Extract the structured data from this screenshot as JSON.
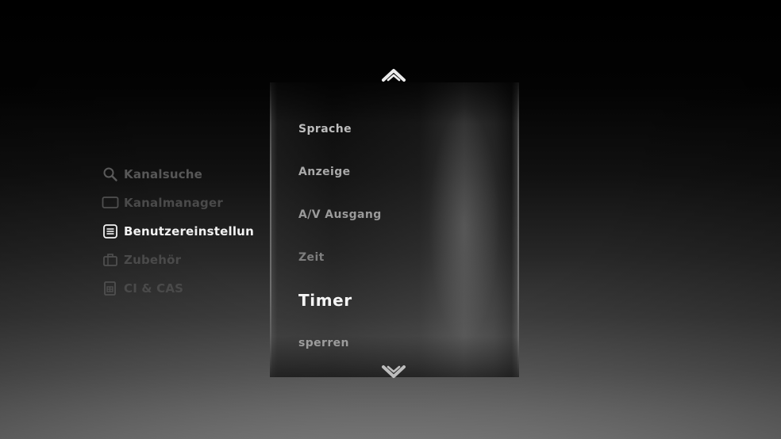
{
  "left_menu": {
    "items": [
      {
        "label": "Kanalsuche",
        "icon": "magnifier-icon",
        "state": "inactive"
      },
      {
        "label": "Kanalmanager",
        "icon": "tv-screen-icon",
        "state": "inactive"
      },
      {
        "label": "Benutzereinstellun",
        "icon": "settings-panel-icon",
        "state": "active"
      },
      {
        "label": "Zubehör",
        "icon": "toolbox-icon",
        "state": "inactive"
      },
      {
        "label": "CI & CAS",
        "icon": "smart-card-icon",
        "state": "inactive"
      }
    ]
  },
  "submenu": {
    "items": [
      {
        "label": "Sprache"
      },
      {
        "label": "Anzeige"
      },
      {
        "label": "A/V Ausgang"
      },
      {
        "label": "Zeit"
      },
      {
        "label": "Timer",
        "selected": true
      },
      {
        "label": "sperren"
      }
    ],
    "scroll_up_icon": "chevron-up-icon",
    "scroll_down_icon": "chevron-down-icon"
  },
  "colors": {
    "active_text": "#f2f2f2",
    "inactive_text": "#575757",
    "submenu_text": "#b4b4b4"
  }
}
